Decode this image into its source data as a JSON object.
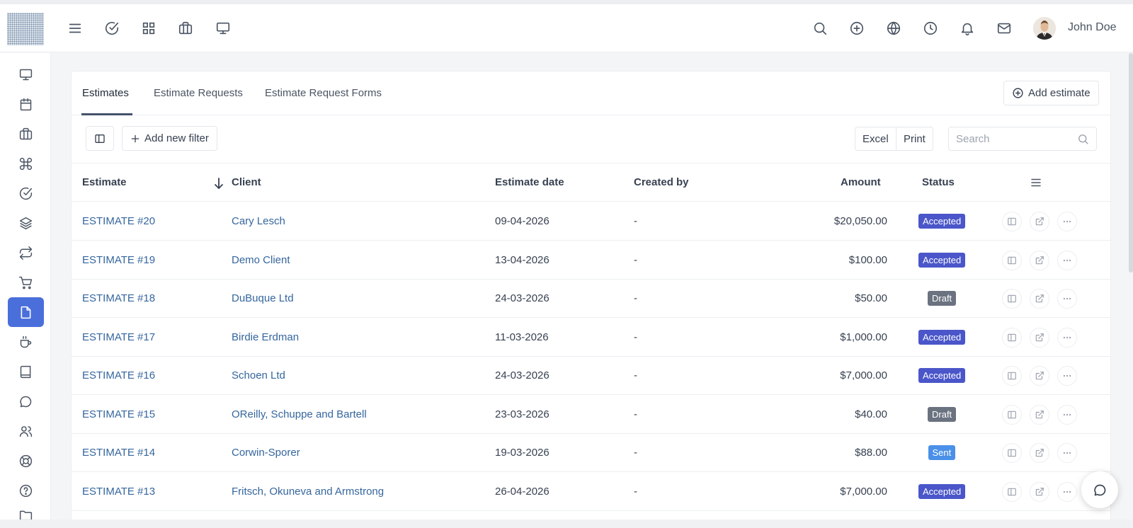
{
  "topbar": {
    "user_name": "John Doe",
    "left_icons": [
      "menu-icon",
      "check-circle-icon",
      "grid-icon",
      "briefcase-icon",
      "monitor-icon"
    ],
    "right_icons": [
      "search-icon",
      "plus-circle-icon",
      "globe-icon",
      "clock-icon",
      "bell-icon",
      "mail-icon"
    ]
  },
  "sidebar": {
    "items": [
      {
        "icon": "monitor-icon",
        "active": false
      },
      {
        "icon": "calendar-icon",
        "active": false
      },
      {
        "icon": "briefcase-icon",
        "active": false
      },
      {
        "icon": "command-icon",
        "active": false
      },
      {
        "icon": "check-circle-icon",
        "active": false
      },
      {
        "icon": "layers-icon",
        "active": false
      },
      {
        "icon": "repeat-icon",
        "active": false
      },
      {
        "icon": "cart-icon",
        "active": false
      },
      {
        "icon": "file-icon",
        "active": true
      },
      {
        "icon": "coffee-icon",
        "active": false
      },
      {
        "icon": "book-icon",
        "active": false
      },
      {
        "icon": "message-icon",
        "active": false
      },
      {
        "icon": "users-icon",
        "active": false
      },
      {
        "icon": "lifebuoy-icon",
        "active": false
      },
      {
        "icon": "help-icon",
        "active": false
      },
      {
        "icon": "folder-icon",
        "active": false
      }
    ]
  },
  "tabs": [
    {
      "label": "Estimates",
      "active": true
    },
    {
      "label": "Estimate Requests",
      "active": false
    },
    {
      "label": "Estimate Request Forms",
      "active": false
    }
  ],
  "actions": {
    "add_estimate_label": "Add estimate",
    "add_filter_label": "Add new filter",
    "excel_label": "Excel",
    "print_label": "Print",
    "search_placeholder": "Search"
  },
  "table": {
    "columns": {
      "estimate": "Estimate",
      "client": "Client",
      "estimate_date": "Estimate date",
      "created_by": "Created by",
      "amount": "Amount",
      "status": "Status"
    },
    "rows": [
      {
        "estimate": "ESTIMATE #20",
        "client": "Cary Lesch",
        "date": "09-04-2026",
        "created_by": "-",
        "amount": "$20,050.00",
        "status": "Accepted"
      },
      {
        "estimate": "ESTIMATE #19",
        "client": "Demo Client",
        "date": "13-04-2026",
        "created_by": "-",
        "amount": "$100.00",
        "status": "Accepted"
      },
      {
        "estimate": "ESTIMATE #18",
        "client": "DuBuque Ltd",
        "date": "24-03-2026",
        "created_by": "-",
        "amount": "$50.00",
        "status": "Draft"
      },
      {
        "estimate": "ESTIMATE #17",
        "client": "Birdie Erdman",
        "date": "11-03-2026",
        "created_by": "-",
        "amount": "$1,000.00",
        "status": "Accepted"
      },
      {
        "estimate": "ESTIMATE #16",
        "client": "Schoen Ltd",
        "date": "24-03-2026",
        "created_by": "-",
        "amount": "$7,000.00",
        "status": "Accepted"
      },
      {
        "estimate": "ESTIMATE #15",
        "client": "OReilly, Schuppe and Bartell",
        "date": "23-03-2026",
        "created_by": "-",
        "amount": "$40.00",
        "status": "Draft"
      },
      {
        "estimate": "ESTIMATE #14",
        "client": "Corwin-Sporer",
        "date": "19-03-2026",
        "created_by": "-",
        "amount": "$88.00",
        "status": "Sent"
      },
      {
        "estimate": "ESTIMATE #13",
        "client": "Fritsch, Okuneva and Armstrong",
        "date": "26-04-2026",
        "created_by": "-",
        "amount": "$7,000.00",
        "status": "Accepted"
      }
    ]
  },
  "status_colors": {
    "Accepted": "#4a56c9",
    "Draft": "#6b7280",
    "Sent": "#4a90e8"
  },
  "accent_color": "#4a6fdb"
}
